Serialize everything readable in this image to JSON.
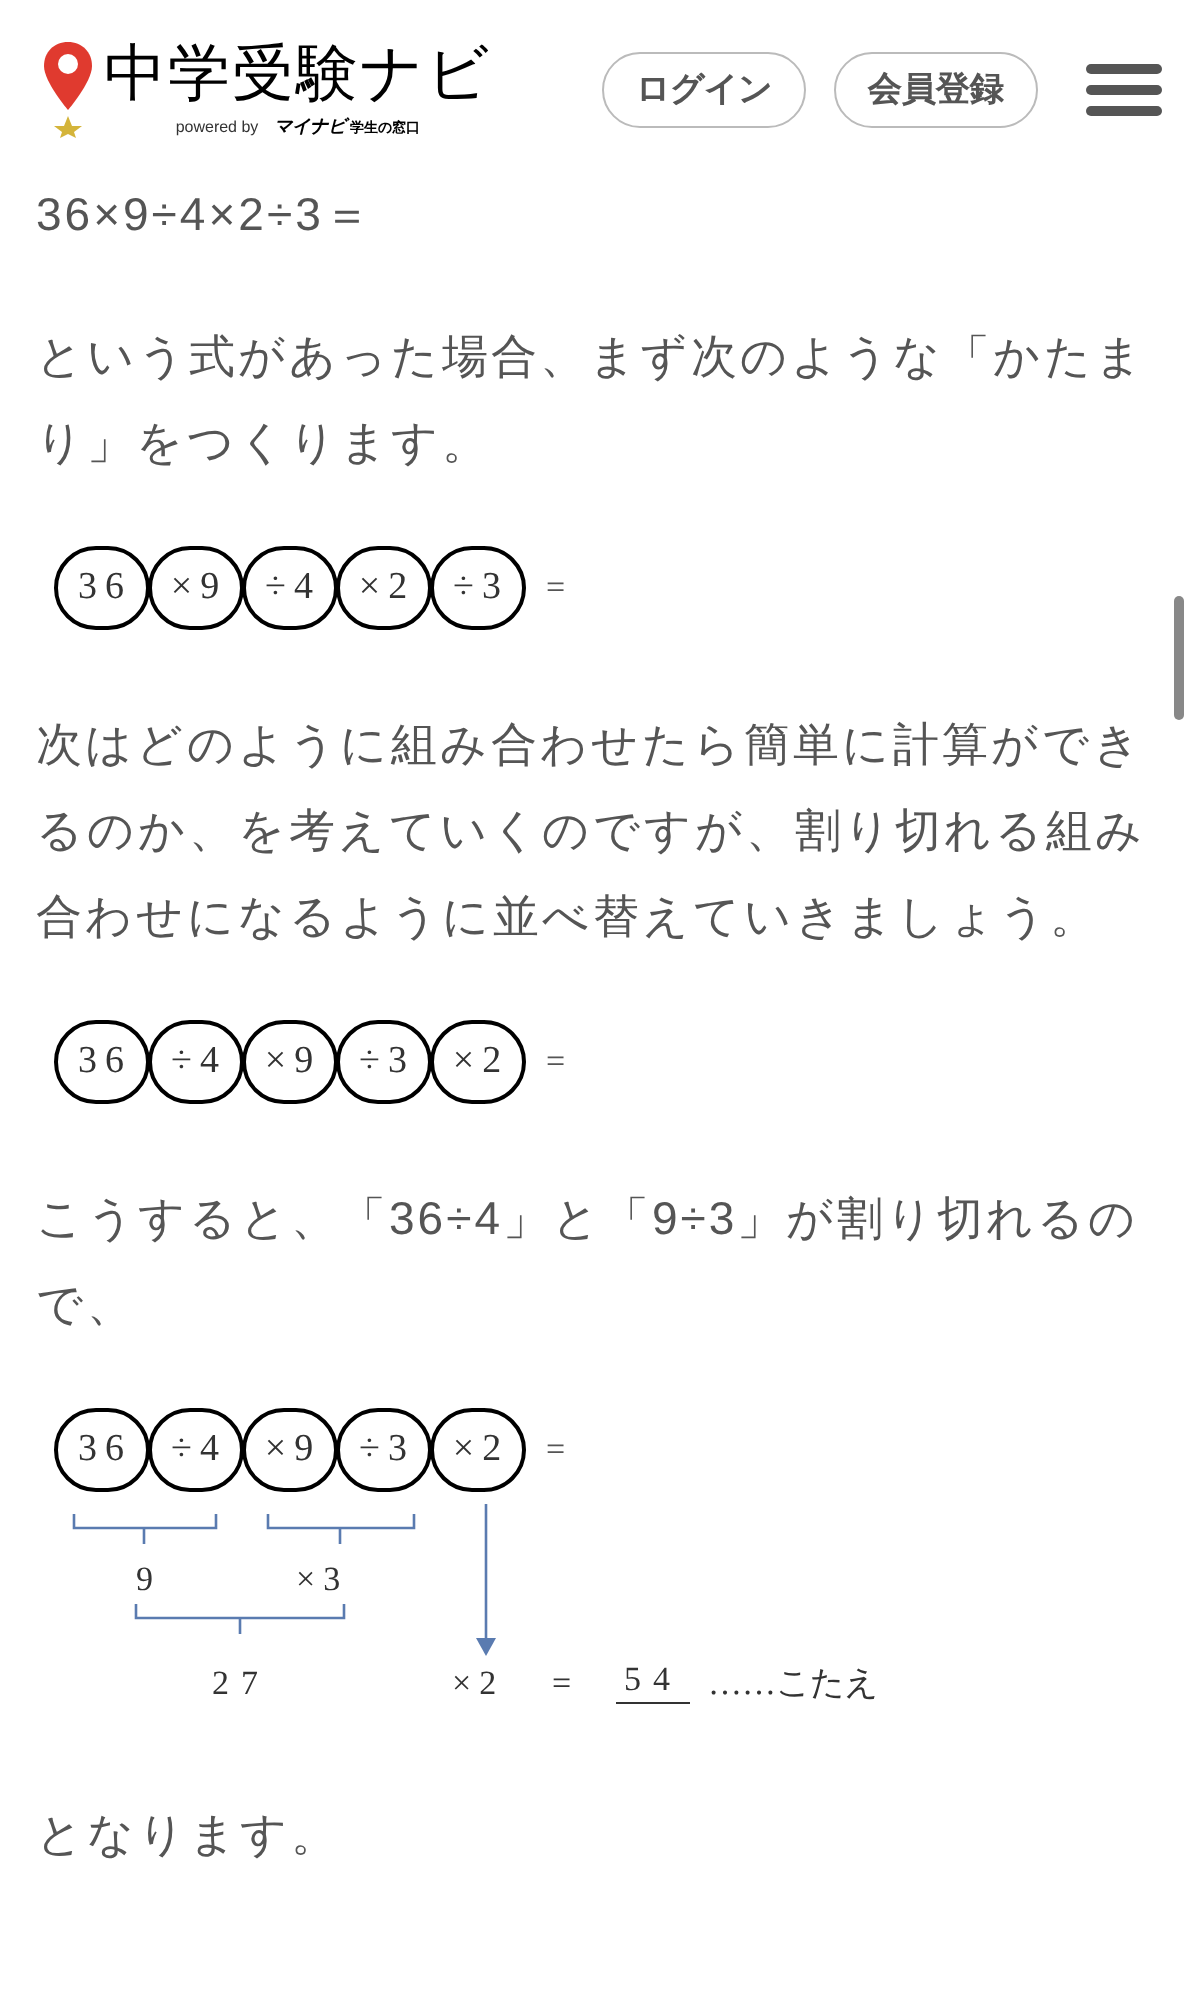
{
  "header": {
    "logo_title": "中学受験ナビ",
    "logo_tagline": "powered by",
    "logo_partner": "マイナビ",
    "logo_partner_sub": "学生の窓口",
    "buttons": [
      "ログイン",
      "会員登録"
    ]
  },
  "content": [
    {
      "kind": "text",
      "text": "36×9÷4×2÷3＝"
    },
    {
      "kind": "text",
      "text": "という式があった場合、まず次のような「かたまり」をつくります。"
    },
    {
      "kind": "circles",
      "items": [
        "36",
        "×9",
        "÷4",
        "×2",
        "÷3"
      ],
      "tail": "="
    },
    {
      "kind": "text",
      "text": "次はどのように組み合わせたら簡単に計算ができるのか、を考えていくのですが、割り切れる組み合わせになるように並べ替えていきましょう。"
    },
    {
      "kind": "circles",
      "items": [
        "36",
        "÷4",
        "×9",
        "÷3",
        "×2"
      ],
      "tail": "="
    },
    {
      "kind": "text",
      "text": "こうすると、「36÷4」と「9÷3」が割り切れるので、"
    },
    {
      "kind": "diagram",
      "items": [
        "36",
        "÷4",
        "×9",
        "÷3",
        "×2"
      ],
      "tail": "=",
      "group_1": "9",
      "group_2": "×3",
      "combined": "27",
      "carried": "×2",
      "equals": "=",
      "answer": "54",
      "answer_label": "……こたえ"
    },
    {
      "kind": "text",
      "text": "となります。"
    }
  ]
}
